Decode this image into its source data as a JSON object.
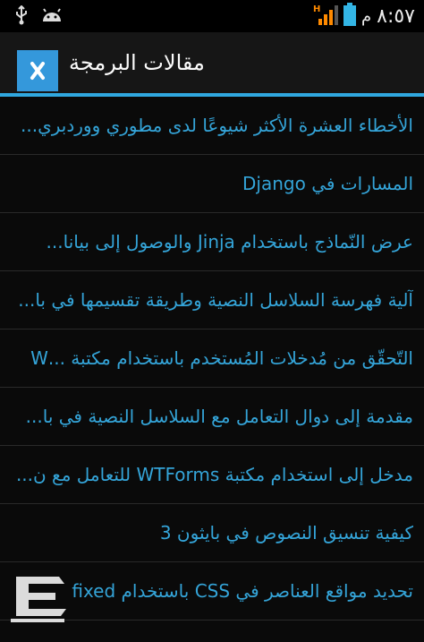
{
  "status_bar": {
    "time": "٨:٥٧",
    "am_pm": "م",
    "icons": [
      "usb-icon",
      "android-icon",
      "battery-icon",
      "signal-icon"
    ]
  },
  "app_bar": {
    "title": "مقالات البرمجة",
    "icon": "xamarin-logo"
  },
  "articles": [
    "الأخطاء العشرة الأكثر شيوعًا لدى مطوري ووردبري...",
    "المسارات في Django",
    "عرض النّماذج باستخدام Jinja والوصول إلى بيانا...",
    "آلية فهرسة السلاسل النصية وطريقة تقسيمها في با...",
    "التّحقّق من مُدخلات المُستخدم باستخدام مكتبة ...W",
    "مقدمة إلى دوال التعامل مع السلاسل النصية في با...",
    "مدخل إلى استخدام مكتبة WTForms للتعامل مع ن...",
    "كيفية تنسيق النصوص في بايثون 3",
    "تحديد مواقع العناصر في CSS باستخدام fixed"
  ],
  "colors": {
    "accent": "#30a8e0",
    "link_text": "#34a4d8",
    "background": "#0a0a0a"
  }
}
